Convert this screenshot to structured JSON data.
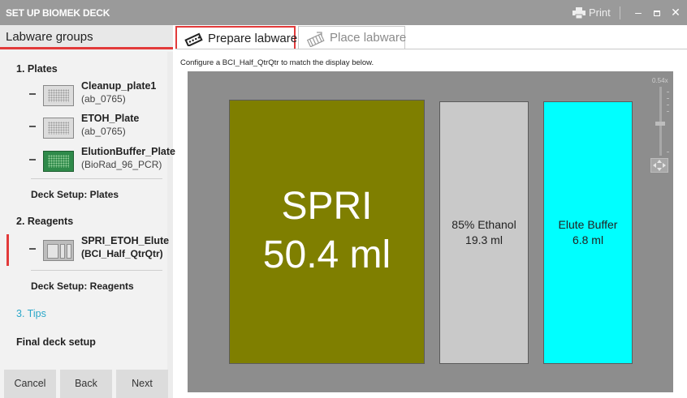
{
  "window": {
    "title": "SET UP BIOMEK DECK",
    "print_label": "Print"
  },
  "sidebar": {
    "header": "Labware groups",
    "sections": {
      "plates": "1. Plates",
      "deck_plates": "Deck Setup: Plates",
      "reagents": "2. Reagents",
      "deck_reagents": "Deck Setup: Reagents",
      "tips": "3. Tips",
      "final": "Final deck setup"
    },
    "plates": [
      {
        "name": "Cleanup_plate1",
        "type": "(ab_0765)"
      },
      {
        "name": "ETOH_Plate",
        "type": "(ab_0765)"
      },
      {
        "name": "ElutionBuffer_Plate",
        "type": "(BioRad_96_PCR)"
      }
    ],
    "reagents": [
      {
        "name": "SPRI_ETOH_Elute",
        "type": "(BCI_Half_QtrQtr)"
      }
    ],
    "buttons": {
      "cancel": "Cancel",
      "back": "Back",
      "next": "Next"
    }
  },
  "tabs": [
    {
      "label": "Prepare labware",
      "active": true
    },
    {
      "label": "Place labware",
      "active": false
    }
  ],
  "instruction": "Configure a BCI_Half_QtrQtr to match the display below.",
  "zoom_label": "0.54x",
  "reservoir": [
    {
      "line1": "SPRI",
      "line2": "50.4 ml",
      "color": "#7f7f00"
    },
    {
      "line1": "85% Ethanol",
      "line2": "19.3 ml",
      "color": "#c9c9c9"
    },
    {
      "line1": "Elute Buffer",
      "line2": "6.8 ml",
      "color": "#00ffff"
    }
  ],
  "colors": {
    "accent": "#e23a3a",
    "tips_link": "#2aa7c9",
    "titlebar": "#9a9a9a",
    "deck_background": "#8d8d8d"
  }
}
